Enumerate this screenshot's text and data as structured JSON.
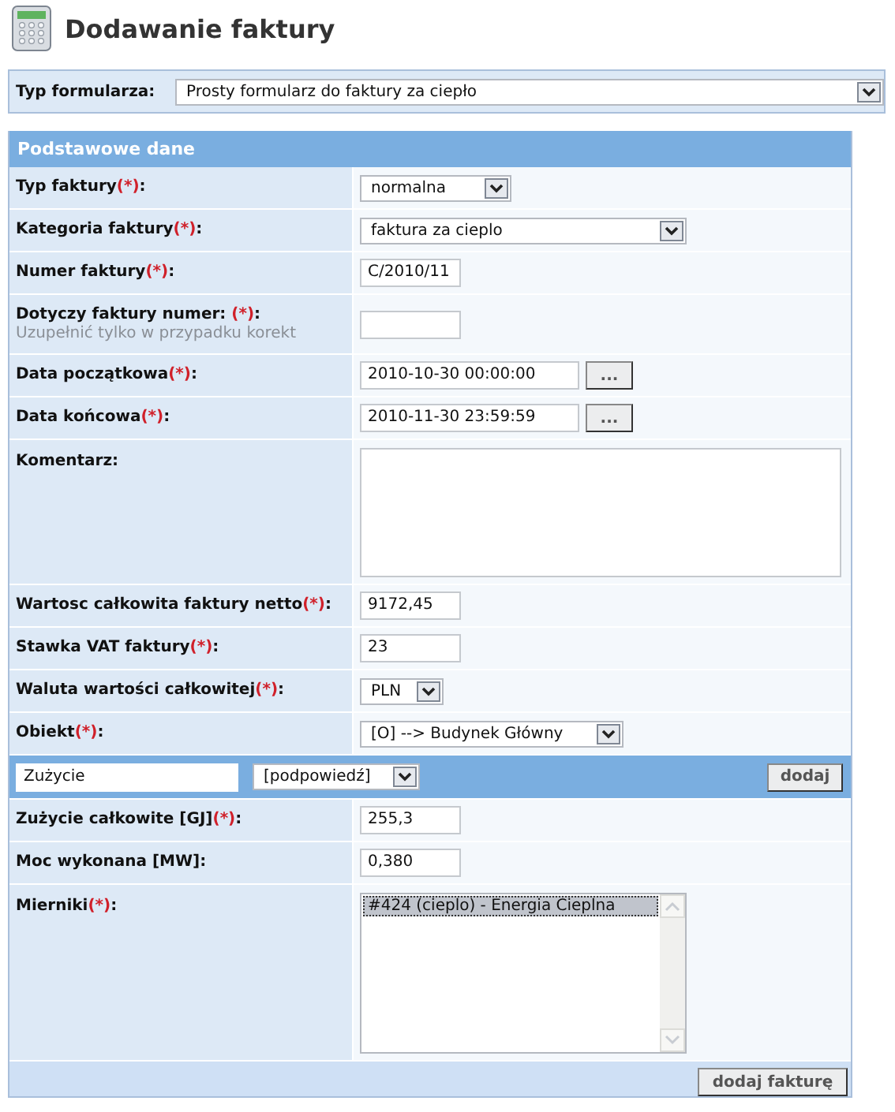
{
  "title": "Dodawanie faktury",
  "form_type": {
    "label": "Typ formularza:",
    "value": "Prosty formularz do faktury za ciepło"
  },
  "section": {
    "title": "Podstawowe dane",
    "rows": [
      {
        "kind": "select",
        "label": "Typ faktury",
        "mark": "(*)",
        "colon": ":",
        "value": "normalna"
      },
      {
        "kind": "select",
        "label": "Kategoria faktury",
        "mark": "(*)",
        "colon": ":",
        "value": "faktura za cieplo"
      },
      {
        "kind": "input",
        "label": "Numer faktury",
        "mark": "(*)",
        "colon": ":",
        "value": "C/2010/11"
      },
      {
        "kind": "input",
        "label": "Dotyczy faktury numer: ",
        "mark": "(*)",
        "colon": ":",
        "hint": "Uzupełnić tylko w przypadku korekt",
        "value": ""
      },
      {
        "kind": "date",
        "label": "Data początkowa",
        "mark": "(*)",
        "colon": ":",
        "value": "2010-10-30 00:00:00",
        "button": "..."
      },
      {
        "kind": "date",
        "label": "Data końcowa",
        "mark": "(*)",
        "colon": ":",
        "value": "2010-11-30 23:59:59",
        "button": "..."
      },
      {
        "kind": "textarea",
        "label": "Komentarz:"
      },
      {
        "kind": "input",
        "label": "Wartosc całkowita faktury netto",
        "mark": "(*)",
        "colon": ":",
        "value": "9172,45"
      },
      {
        "kind": "input",
        "label": "Stawka VAT faktury",
        "mark": "(*)",
        "colon": ":",
        "value": "23"
      },
      {
        "kind": "select",
        "label": "Waluta wartości całkowitej",
        "mark": "(*)",
        "colon": ":",
        "value": "PLN"
      },
      {
        "kind": "select",
        "label": "Obiekt",
        "mark": "(*)",
        "colon": ":",
        "value": "[O] --> Budynek Główny"
      },
      {
        "kind": "add_bar",
        "value": "Zużycie",
        "select": "[podpowiedź]",
        "button": "dodaj"
      },
      {
        "kind": "input",
        "label": "Zużycie całkowite [GJ]",
        "mark": "(*)",
        "colon": ":",
        "value": "255,3"
      },
      {
        "kind": "input",
        "label": "Moc wykonana [MW]:",
        "value": "0,380"
      },
      {
        "kind": "listbox",
        "label": "Mierniki",
        "mark": "(*)",
        "colon": ":",
        "options": [
          {
            "text": "#424 (cieplo) - Energia Cieplna",
            "selected": true
          }
        ]
      }
    ],
    "submit": "dodaj fakturę"
  }
}
